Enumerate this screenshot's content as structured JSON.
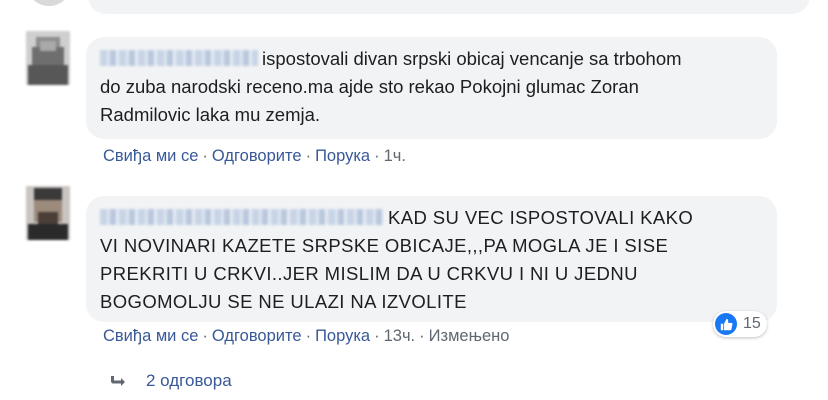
{
  "comments": [
    {
      "text_lines": [
        "ispostovali divan srpski obicaj vencanje sa trbohom",
        "do zuba narodski receno.ma ajde sto rekao Pokojni glumac Zoran",
        "Radmilovic laka mu zemja."
      ],
      "actions": {
        "like": "Свиђа ми се",
        "reply": "Одговорите",
        "message": "Порука",
        "time": "1ч."
      }
    },
    {
      "text_lines": [
        "KAD SU VEC ISPOSTOVALI KAKO",
        "VI NOVINARI KAZETE SRPSKE OBICAJE,,,PA MOGLA JE I SISE",
        "PREKRITI U CRKVI..JER MISLIM DA U CRKVU I NI U JEDNU",
        "BOGOMOLJU SE NE ULAZI NA IZVOLITE"
      ],
      "actions": {
        "like": "Свиђа ми се",
        "reply": "Одговорите",
        "message": "Порука",
        "time": "13ч.",
        "edited": "Измењено"
      },
      "reactions": {
        "icon": "thumbs-up-icon",
        "count": "15"
      }
    }
  ],
  "replies_link": {
    "icon": "reply-arrow-icon",
    "label": "2 одговора"
  },
  "colors": {
    "bubble": "#f2f3f5",
    "link": "#385898",
    "meta": "#606770",
    "like_blue": "#1877f2"
  }
}
